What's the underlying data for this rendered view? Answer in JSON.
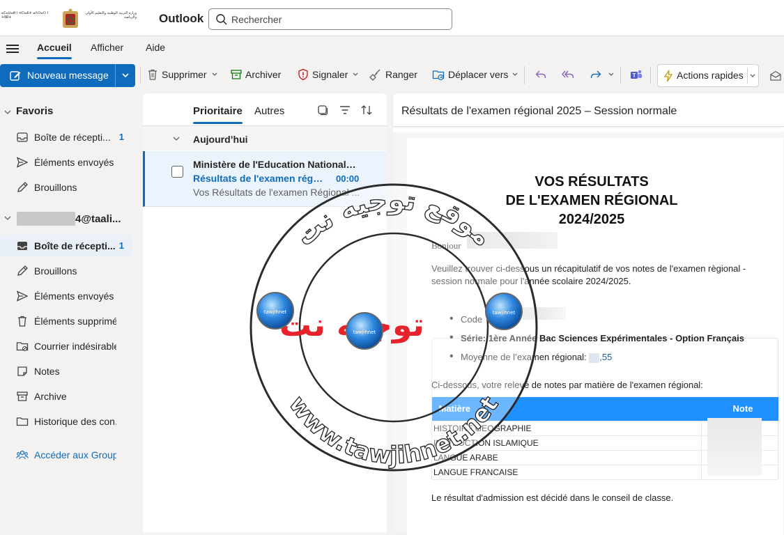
{
  "header": {
    "logo_left_text": "ⴰⵎⴰⵡⴰⵍ ⵏ ⵜⵎⵏⴰⴹⵜ ⴰⴷⵔⴰⵔ ⵏ ⵜⵓⴽⵜ",
    "logo_right_text": "وزارة التربية الوطنية والتعليم الأولي والرياضة",
    "app_name": "Outlook",
    "search_placeholder": "Rechercher"
  },
  "nav": {
    "tabs": [
      {
        "label": "Accueil",
        "active": true
      },
      {
        "label": "Afficher",
        "active": false
      },
      {
        "label": "Aide",
        "active": false
      }
    ]
  },
  "ribbon": {
    "new_message": "Nouveau message",
    "delete": "Supprimer",
    "archive": "Archiver",
    "report": "Signaler",
    "sweep": "Ranger",
    "move": "Déplacer vers",
    "quick_actions": "Actions rapides"
  },
  "folders": {
    "favorites_label": "Favoris",
    "favorites": [
      {
        "label": "Boîte de récepti...",
        "count": "1",
        "icon": "inbox-icon"
      },
      {
        "label": "Éléments envoyés",
        "count": "",
        "icon": "send-icon"
      },
      {
        "label": "Brouillons",
        "count": "",
        "icon": "draft-icon"
      }
    ],
    "account_label": "4@taali...",
    "account_items": [
      {
        "label": "Boîte de récepti...",
        "count": "1",
        "icon": "inbox-icon",
        "selected": true
      },
      {
        "label": "Brouillons",
        "count": "",
        "icon": "draft-icon"
      },
      {
        "label": "Éléments envoyés",
        "count": "",
        "icon": "send-icon"
      },
      {
        "label": "Éléments supprimés",
        "count": "",
        "icon": "trash-icon"
      },
      {
        "label": "Courrier indésirable",
        "count": "",
        "icon": "junk-icon"
      },
      {
        "label": "Notes",
        "count": "",
        "icon": "note-icon"
      },
      {
        "label": "Archive",
        "count": "",
        "icon": "archive-icon"
      },
      {
        "label": "Historique des con...",
        "count": "",
        "icon": "folder-icon"
      }
    ],
    "groups_link": "Accéder aux Group..."
  },
  "message_list": {
    "tab_focused": "Prioritaire",
    "tab_other": "Autres",
    "group_label": "Aujourd’hui",
    "items": [
      {
        "sender": "Ministère de l'Education Nationale,...",
        "subject": "Résultats de l'examen régio...",
        "time": "00:00",
        "preview": "Vos Résultats de l'examen Régional ..."
      }
    ]
  },
  "reading": {
    "subject": "Résultats de l'examen régional 2025 – Session normale",
    "title_lines": [
      "VOS RÉSULTATS",
      "DE L'EXAMEN RÉGIONAL",
      "2024/2025"
    ],
    "greeting": "Bonjour",
    "intro_line1": "Veuillez trouver ci-dessous un récapitulatif de vos notes de l'examen règional  -",
    "intro_line2": "session normale pour l'année scolaire 2024/2025.",
    "bullets": {
      "code": "Code",
      "serie": "Série: 1ère Année Bac Sciences Expérimentales - Option Français",
      "moyenne_label": "Moyenne de l’examen régional: ",
      "moyenne_value": ",55"
    },
    "table_intro": "Ci-dessous, votre relevé de notes par matière de l'examen régional:",
    "table_headers": [
      "Matière",
      "Note"
    ],
    "subjects": [
      "HISTOIRE GEOGRAPHIE",
      "INSTRUCTION ISLAMIQUE",
      "LANGUE ARABE",
      "LANGUE FRANCAISE"
    ],
    "footer_text": "Le résultat d'admission est décidé dans le conseil de classe."
  },
  "watermark": {
    "arabic_text": "توجيه نت",
    "ring_text_top": "موقع توجيه نت",
    "ring_text_bottom": "www.tawjihnet.net",
    "badge_text": "tawjihnet"
  },
  "colors": {
    "accent": "#0f6cbd",
    "table_header": "#1e90ff",
    "watermark_red": "#e8222a"
  }
}
